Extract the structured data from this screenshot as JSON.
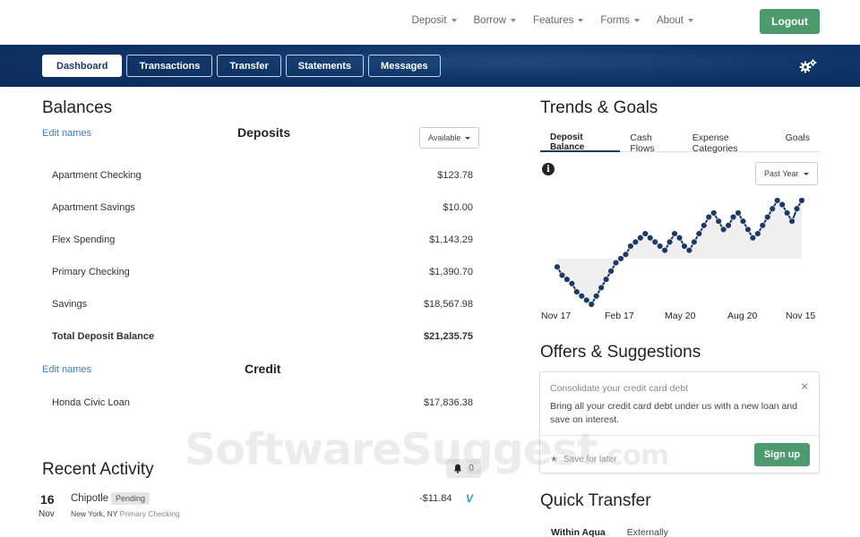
{
  "topnav": {
    "items": [
      "Deposit",
      "Borrow",
      "Features",
      "Forms",
      "About"
    ],
    "logout_label": "Logout"
  },
  "tabs": [
    "Dashboard",
    "Transactions",
    "Transfer",
    "Statements",
    "Messages"
  ],
  "balances": {
    "title": "Balances",
    "edit_names": "Edit names",
    "deposits_title": "Deposits",
    "filter_label": "Available",
    "deposits": [
      {
        "name": "Apartment Checking",
        "amount": "$123.78"
      },
      {
        "name": "Apartment Savings",
        "amount": "$10.00"
      },
      {
        "name": "Flex Spending",
        "amount": "$1,143.29"
      },
      {
        "name": "Primary Checking",
        "amount": "$1,390.70"
      },
      {
        "name": "Savings",
        "amount": "$18,567.98"
      }
    ],
    "total": {
      "name": "Total Deposit Balance",
      "amount": "$21,235.75"
    },
    "credit_edit_names": "Edit names",
    "credit_title": "Credit",
    "credit": [
      {
        "name": "Honda Civic Loan",
        "amount": "$17,836.38"
      }
    ]
  },
  "activity": {
    "title": "Recent Activity",
    "notification_count": "0",
    "items": [
      {
        "day": "16",
        "month": "Nov",
        "merchant": "Chipotle",
        "status": "Pending",
        "location": "New York, NY",
        "account": "Primary Checking",
        "amount": "-$11.84",
        "payment_icon": "V"
      }
    ]
  },
  "trends": {
    "title": "Trends & Goals",
    "tabs": [
      "Deposit Balance",
      "Cash Flows",
      "Expense Categories",
      "Goals"
    ],
    "range_label": "Past Year",
    "info_icon": "i"
  },
  "chart_data": {
    "type": "area",
    "series": [
      {
        "values": [
          31,
          29,
          28,
          27,
          25,
          24,
          23,
          22,
          24,
          26,
          28,
          30,
          32,
          33,
          34,
          36,
          37,
          38,
          39,
          38,
          37,
          36,
          35,
          37,
          39,
          38,
          36,
          35,
          37,
          39,
          41,
          43,
          44,
          42,
          40,
          41,
          43,
          44,
          42,
          40,
          38,
          39,
          41,
          43,
          45,
          47,
          46,
          44,
          42,
          45,
          47
        ]
      }
    ],
    "x_ticks": [
      "Nov 17",
      "Feb 17",
      "May 20",
      "Aug 20",
      "Nov 15"
    ],
    "grid": false,
    "fill_color": "#efefef",
    "line_color": "#1b3a66"
  },
  "offers": {
    "title": "Offers & Suggestions",
    "card": {
      "heading": "Consolidate your credit card debt",
      "body": "Bring all your credit card debt under us with a new loan and save on interest.",
      "save_label": "Save for later",
      "cta_label": "Sign up"
    }
  },
  "quick_transfer": {
    "title": "Quick Transfer",
    "tabs": [
      "Within Aqua",
      "Externally"
    ]
  },
  "watermark": {
    "main": "SoftwareSuggest",
    "suffix": ".com"
  },
  "colors": {
    "accent_green": "#4e9a6f",
    "navy": "#1b3a66",
    "link_blue": "#3b7bbf"
  }
}
